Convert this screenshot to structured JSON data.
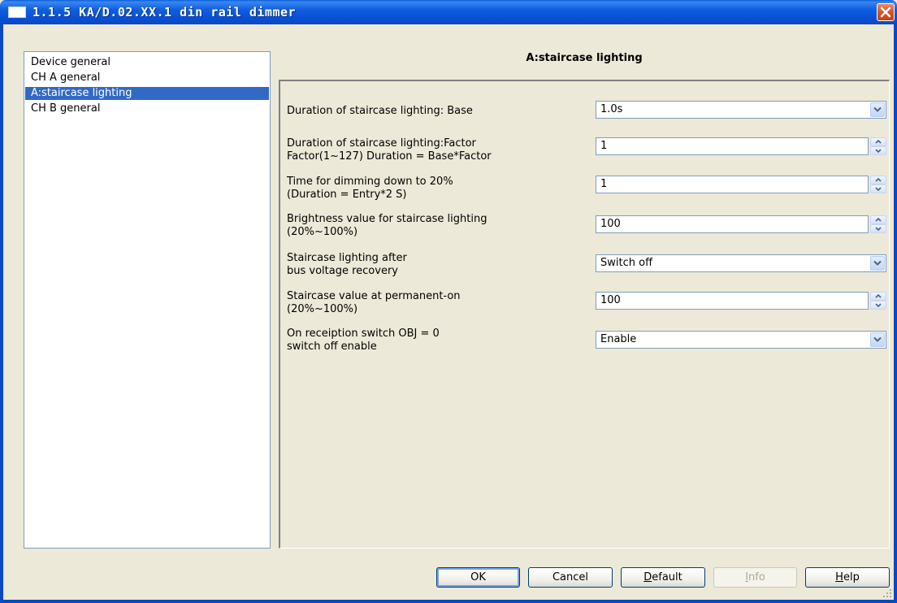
{
  "window": {
    "title": "1.1.5 KA/D.02.XX.1 din rail dimmer"
  },
  "tree": {
    "items": [
      {
        "label": "Device general",
        "selected": false
      },
      {
        "label": "CH A general",
        "selected": false
      },
      {
        "label": "A:staircase lighting",
        "selected": true
      },
      {
        "label": "CH B general",
        "selected": false
      }
    ]
  },
  "section": {
    "title": "A:staircase lighting"
  },
  "params": [
    {
      "line1": "Duration of staircase lighting: Base",
      "line2": "",
      "control": "combo",
      "value": "1.0s"
    },
    {
      "line1": "Duration of staircase lighting:Factor",
      "line2": "Factor(1~127)  Duration = Base*Factor",
      "control": "spin",
      "value": "1"
    },
    {
      "line1": "Time for dimming down to 20%",
      "line2": "(Duration = Entry*2 S)",
      "control": "spin",
      "value": "1"
    },
    {
      "line1": "Brightness value for staircase lighting",
      "line2": "(20%~100%)",
      "control": "spin",
      "value": "100"
    },
    {
      "line1": "Staircase lighting after",
      "line2": "bus voltage recovery",
      "control": "combo",
      "value": "Switch off"
    },
    {
      "line1": "Staircase value at permanent-on",
      "line2": "(20%~100%)",
      "control": "spin",
      "value": "100"
    },
    {
      "line1": "On receiption switch OBJ = 0",
      "line2": "switch off enable",
      "control": "combo",
      "value": "Enable"
    }
  ],
  "buttons": {
    "ok": "OK",
    "cancel": "Cancel",
    "default_first": "D",
    "default_rest": "efault",
    "info_first": "I",
    "info_rest": "nfo",
    "help_first": "H",
    "help_rest": "elp"
  },
  "colors": {
    "titlebar": "#0a48c4",
    "selection": "#316ac5",
    "close": "#d4552a"
  },
  "icons": {
    "app": "window-icon",
    "close": "close-icon",
    "dropdown": "chevron-down-icon",
    "spin_up": "spin-up-icon",
    "spin_down": "spin-down-icon",
    "grip": "resize-grip-icon"
  }
}
